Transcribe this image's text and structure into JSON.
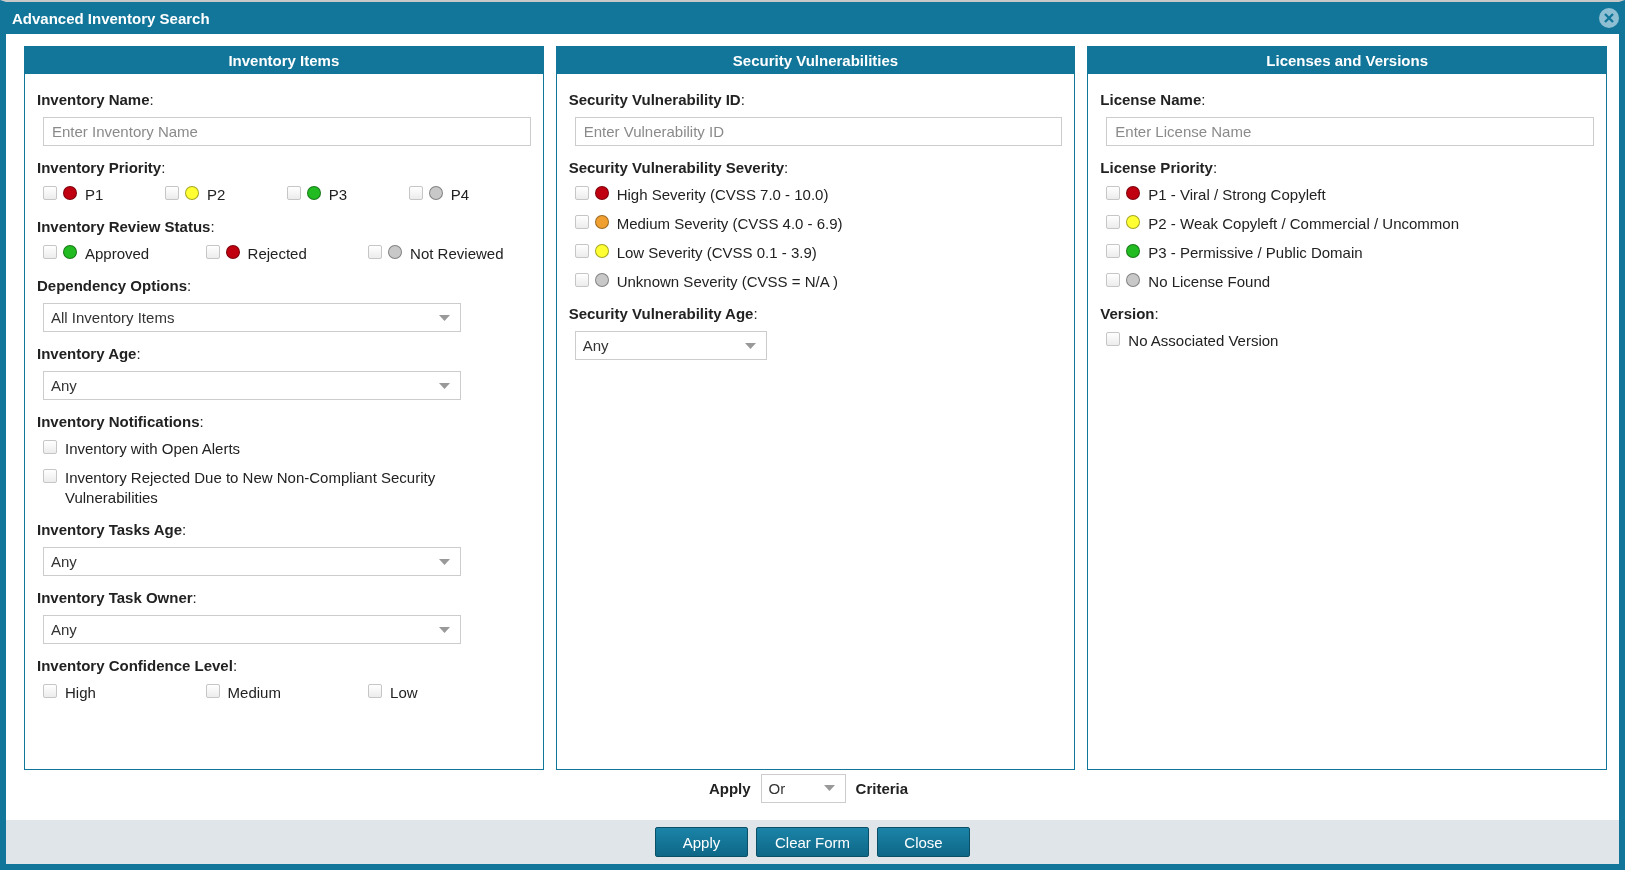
{
  "window": {
    "title": "Advanced Inventory Search"
  },
  "panels": [
    {
      "title": "Inventory Items",
      "fields": [
        {
          "kind": "text",
          "label": "**Inventory Name**:",
          "placeholder": "Enter Inventory Name"
        },
        {
          "kind": "check-row",
          "label": "**Inventory Priority**:",
          "options": [
            {
              "label": "P1",
              "color": "#c00010",
              "checked": false
            },
            {
              "label": "P2",
              "color": "#ffff33",
              "checked": false
            },
            {
              "label": "P3",
              "color": "#22bb22",
              "checked": false
            },
            {
              "label": "P4",
              "color": "#c8c8c8",
              "checked": false
            }
          ]
        },
        {
          "kind": "check-row",
          "label": "**Inventory Review Status**:",
          "options": [
            {
              "label": "Approved",
              "color": "#22bb22",
              "checked": false
            },
            {
              "label": "Rejected",
              "color": "#c00010",
              "checked": false
            },
            {
              "label": "Not Reviewed",
              "color": "#c8c8c8",
              "checked": false
            }
          ]
        },
        {
          "kind": "select",
          "label": "**Dependency Options**:",
          "value": "All Inventory Items"
        },
        {
          "kind": "select",
          "label": "**Inventory Age**:",
          "value": "Any"
        },
        {
          "kind": "check-list",
          "label": "**Inventory Notifications**:",
          "options": [
            {
              "label": "Inventory with Open Alerts",
              "checked": false
            },
            {
              "label": "Inventory Rejected Due to New Non-Compliant Security Vulnerabilities",
              "checked": false
            }
          ]
        },
        {
          "kind": "select",
          "label": "**Inventory Tasks Age**:",
          "value": "Any"
        },
        {
          "kind": "select",
          "label": "**Inventory Task Owner**:",
          "value": "Any"
        },
        {
          "kind": "check-row",
          "label": "**Inventory Confidence Level**:",
          "options": [
            {
              "label": "High",
              "checked": false
            },
            {
              "label": "Medium",
              "checked": false
            },
            {
              "label": "Low",
              "checked": false
            }
          ]
        }
      ]
    },
    {
      "title": "Security Vulnerabilities",
      "fields": [
        {
          "kind": "text",
          "label": "**Security Vulnerability ID**:",
          "placeholder": "Enter Vulnerability ID"
        },
        {
          "kind": "check-list",
          "label": "**Security Vulnerability Severity**:",
          "options": [
            {
              "label": "High Severity (CVSS 7.0 - 10.0)",
              "color": "#c00010",
              "checked": false
            },
            {
              "label": "Medium Severity (CVSS 4.0 - 6.9)",
              "color": "#f0a030",
              "checked": false
            },
            {
              "label": "Low Severity (CVSS 0.1 - 3.9)",
              "color": "#ffff33",
              "checked": false
            },
            {
              "label": "Unknown Severity (CVSS = N/A )",
              "color": "#c8c8c8",
              "checked": false
            }
          ]
        },
        {
          "kind": "short-select",
          "label": "**Security Vulnerability Age**:",
          "value": "Any"
        }
      ]
    },
    {
      "title": "Licenses and Versions",
      "fields": [
        {
          "kind": "text",
          "label": "**License Name**:",
          "placeholder": "Enter License Name"
        },
        {
          "kind": "check-list",
          "label": "**License Priority**:",
          "options": [
            {
              "label": "P1 - Viral / Strong Copyleft",
              "color": "#c00010",
              "checked": false
            },
            {
              "label": "P2 - Weak Copyleft / Commercial / Uncommon",
              "color": "#ffff33",
              "checked": false
            },
            {
              "label": "P3 - Permissive / Public Domain",
              "color": "#22bb22",
              "checked": false
            },
            {
              "label": "No License Found",
              "color": "#c8c8c8",
              "checked": false
            }
          ]
        },
        {
          "kind": "check-list",
          "label": "**Version**:",
          "options": [
            {
              "label": "No Associated Version",
              "checked": false
            }
          ]
        }
      ]
    }
  ],
  "criteria": {
    "prefix": "Apply",
    "value": "Or",
    "suffix": "Criteria"
  },
  "buttons": [
    "Apply",
    "Clear Form",
    "Close"
  ]
}
